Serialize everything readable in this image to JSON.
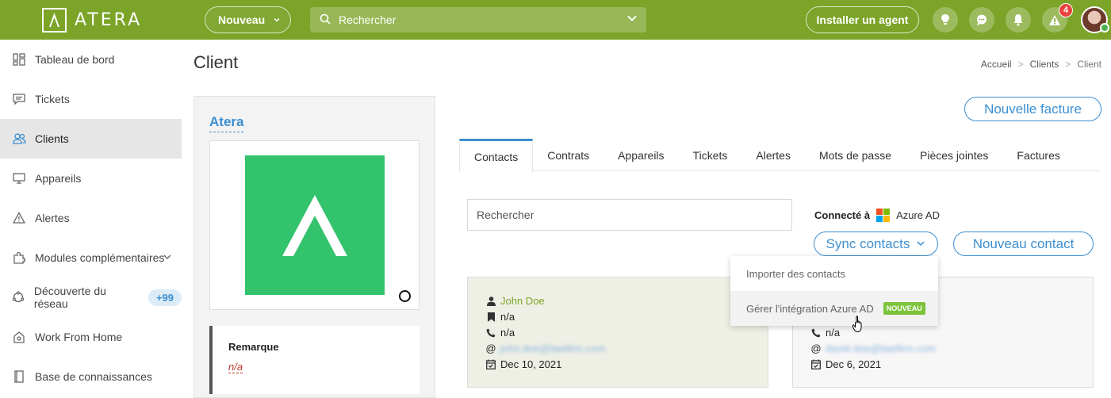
{
  "topbar": {
    "logo_text": "ATERA",
    "new_label": "Nouveau",
    "search_placeholder": "Rechercher",
    "install_agent": "Installer un agent",
    "alert_count": "4"
  },
  "sidebar": {
    "items": [
      {
        "label": "Tableau de bord",
        "icon": "dashboard-icon"
      },
      {
        "label": "Tickets",
        "icon": "ticket-icon"
      },
      {
        "label": "Clients",
        "icon": "clients-icon",
        "active": true
      },
      {
        "label": "Appareils",
        "icon": "monitor-icon"
      },
      {
        "label": "Alertes",
        "icon": "warning-icon"
      },
      {
        "label": "Modules complémentaires",
        "icon": "puzzle-icon"
      },
      {
        "label": "Découverte du réseau",
        "icon": "network-icon",
        "badge": "+99"
      },
      {
        "label": "Work From Home",
        "icon": "home-icon"
      },
      {
        "label": "Base de connaissances",
        "icon": "book-icon"
      }
    ]
  },
  "page": {
    "title": "Client",
    "breadcrumb": [
      "Accueil",
      "Clients",
      "Client"
    ]
  },
  "client": {
    "name": "Atera",
    "remark_title": "Remarque",
    "remark_value": "n/a"
  },
  "actions": {
    "new_invoice": "Nouvelle facture",
    "sync_contacts": "Sync contacts",
    "new_contact": "Nouveau contact"
  },
  "tabs": [
    "Contacts",
    "Contrats",
    "Appareils",
    "Tickets",
    "Alertes",
    "Mots de passe",
    "Pièces jointes",
    "Factures"
  ],
  "contacts_search": {
    "placeholder": "Rechercher"
  },
  "connected": {
    "label": "Connecté à",
    "service": "Azure AD"
  },
  "dropdown": {
    "import": "Importer des contacts",
    "manage": "Gérer l'intégration Azure AD",
    "badge": "NOUVEAU"
  },
  "contacts": [
    {
      "name": "John Doe",
      "role": "n/a",
      "phone": "n/a",
      "email": "john.doe@lawfirm.com",
      "date": "Dec 10, 2021"
    },
    {
      "phone": "n/a",
      "email": "david.doe@lawfirm.com",
      "date": "Dec 6, 2021"
    }
  ],
  "colors": {
    "brand_green": "#7ba428",
    "link_blue": "#3c8ed0",
    "logo_green": "#32c36c"
  }
}
